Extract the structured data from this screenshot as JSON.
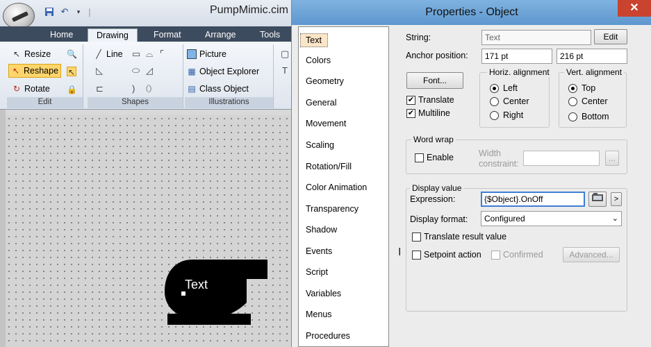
{
  "app": {
    "doc_title": "PumpMimic.cim",
    "tabs": [
      "Home",
      "Drawing",
      "Format",
      "Arrange",
      "Tools"
    ],
    "active_tab": "Drawing",
    "groups": {
      "edit": {
        "label": "Edit",
        "resize": "Resize",
        "reshape": "Reshape",
        "rotate": "Rotate"
      },
      "shapes": {
        "label": "Shapes",
        "line": "Line"
      },
      "illustrations": {
        "label": "Illustrations",
        "picture": "Picture",
        "object_explorer": "Object Explorer",
        "class_object": "Class Object"
      }
    },
    "canvas": {
      "object_text": "Text"
    }
  },
  "dialog": {
    "title": "Properties - Object",
    "close_glyph": "✕",
    "categories": [
      "Text",
      "Colors",
      "Geometry",
      "General",
      "Movement",
      "Scaling",
      "Rotation/Fill",
      "Color Animation",
      "Transparency",
      "Shadow",
      "Events",
      "Script",
      "Variables",
      "Menus",
      "Procedures"
    ],
    "selected_category": "Text",
    "string_label": "String:",
    "string_value": "Text",
    "edit_button": "Edit",
    "anchor_label": "Anchor position:",
    "anchor_x": "171 pt",
    "anchor_y": "216 pt",
    "font_button": "Font...",
    "translate": {
      "label": "Translate",
      "checked": true
    },
    "multiline": {
      "label": "Multiline",
      "checked": true
    },
    "horiz_align": {
      "legend": "Horiz. alignment",
      "options": [
        "Left",
        "Center",
        "Right"
      ],
      "selected": "Left"
    },
    "vert_align": {
      "legend": "Vert. alignment",
      "options": [
        "Top",
        "Center",
        "Bottom"
      ],
      "selected": "Top"
    },
    "word_wrap": {
      "legend": "Word wrap",
      "enable_label": "Enable",
      "width_label_1": "Width",
      "width_label_2": "constraint:",
      "browse_glyph": "..."
    },
    "display_value": {
      "legend": "Display value",
      "expression_label": "Expression:",
      "expression_value": "{$Object}.OnOff",
      "more_button": ">",
      "format_label": "Display format:",
      "format_value": "Configured",
      "translate_result_label": "Translate result value",
      "setpoint_label": "Setpoint action",
      "confirmed_label": "Confirmed",
      "advanced_button": "Advanced..."
    }
  }
}
